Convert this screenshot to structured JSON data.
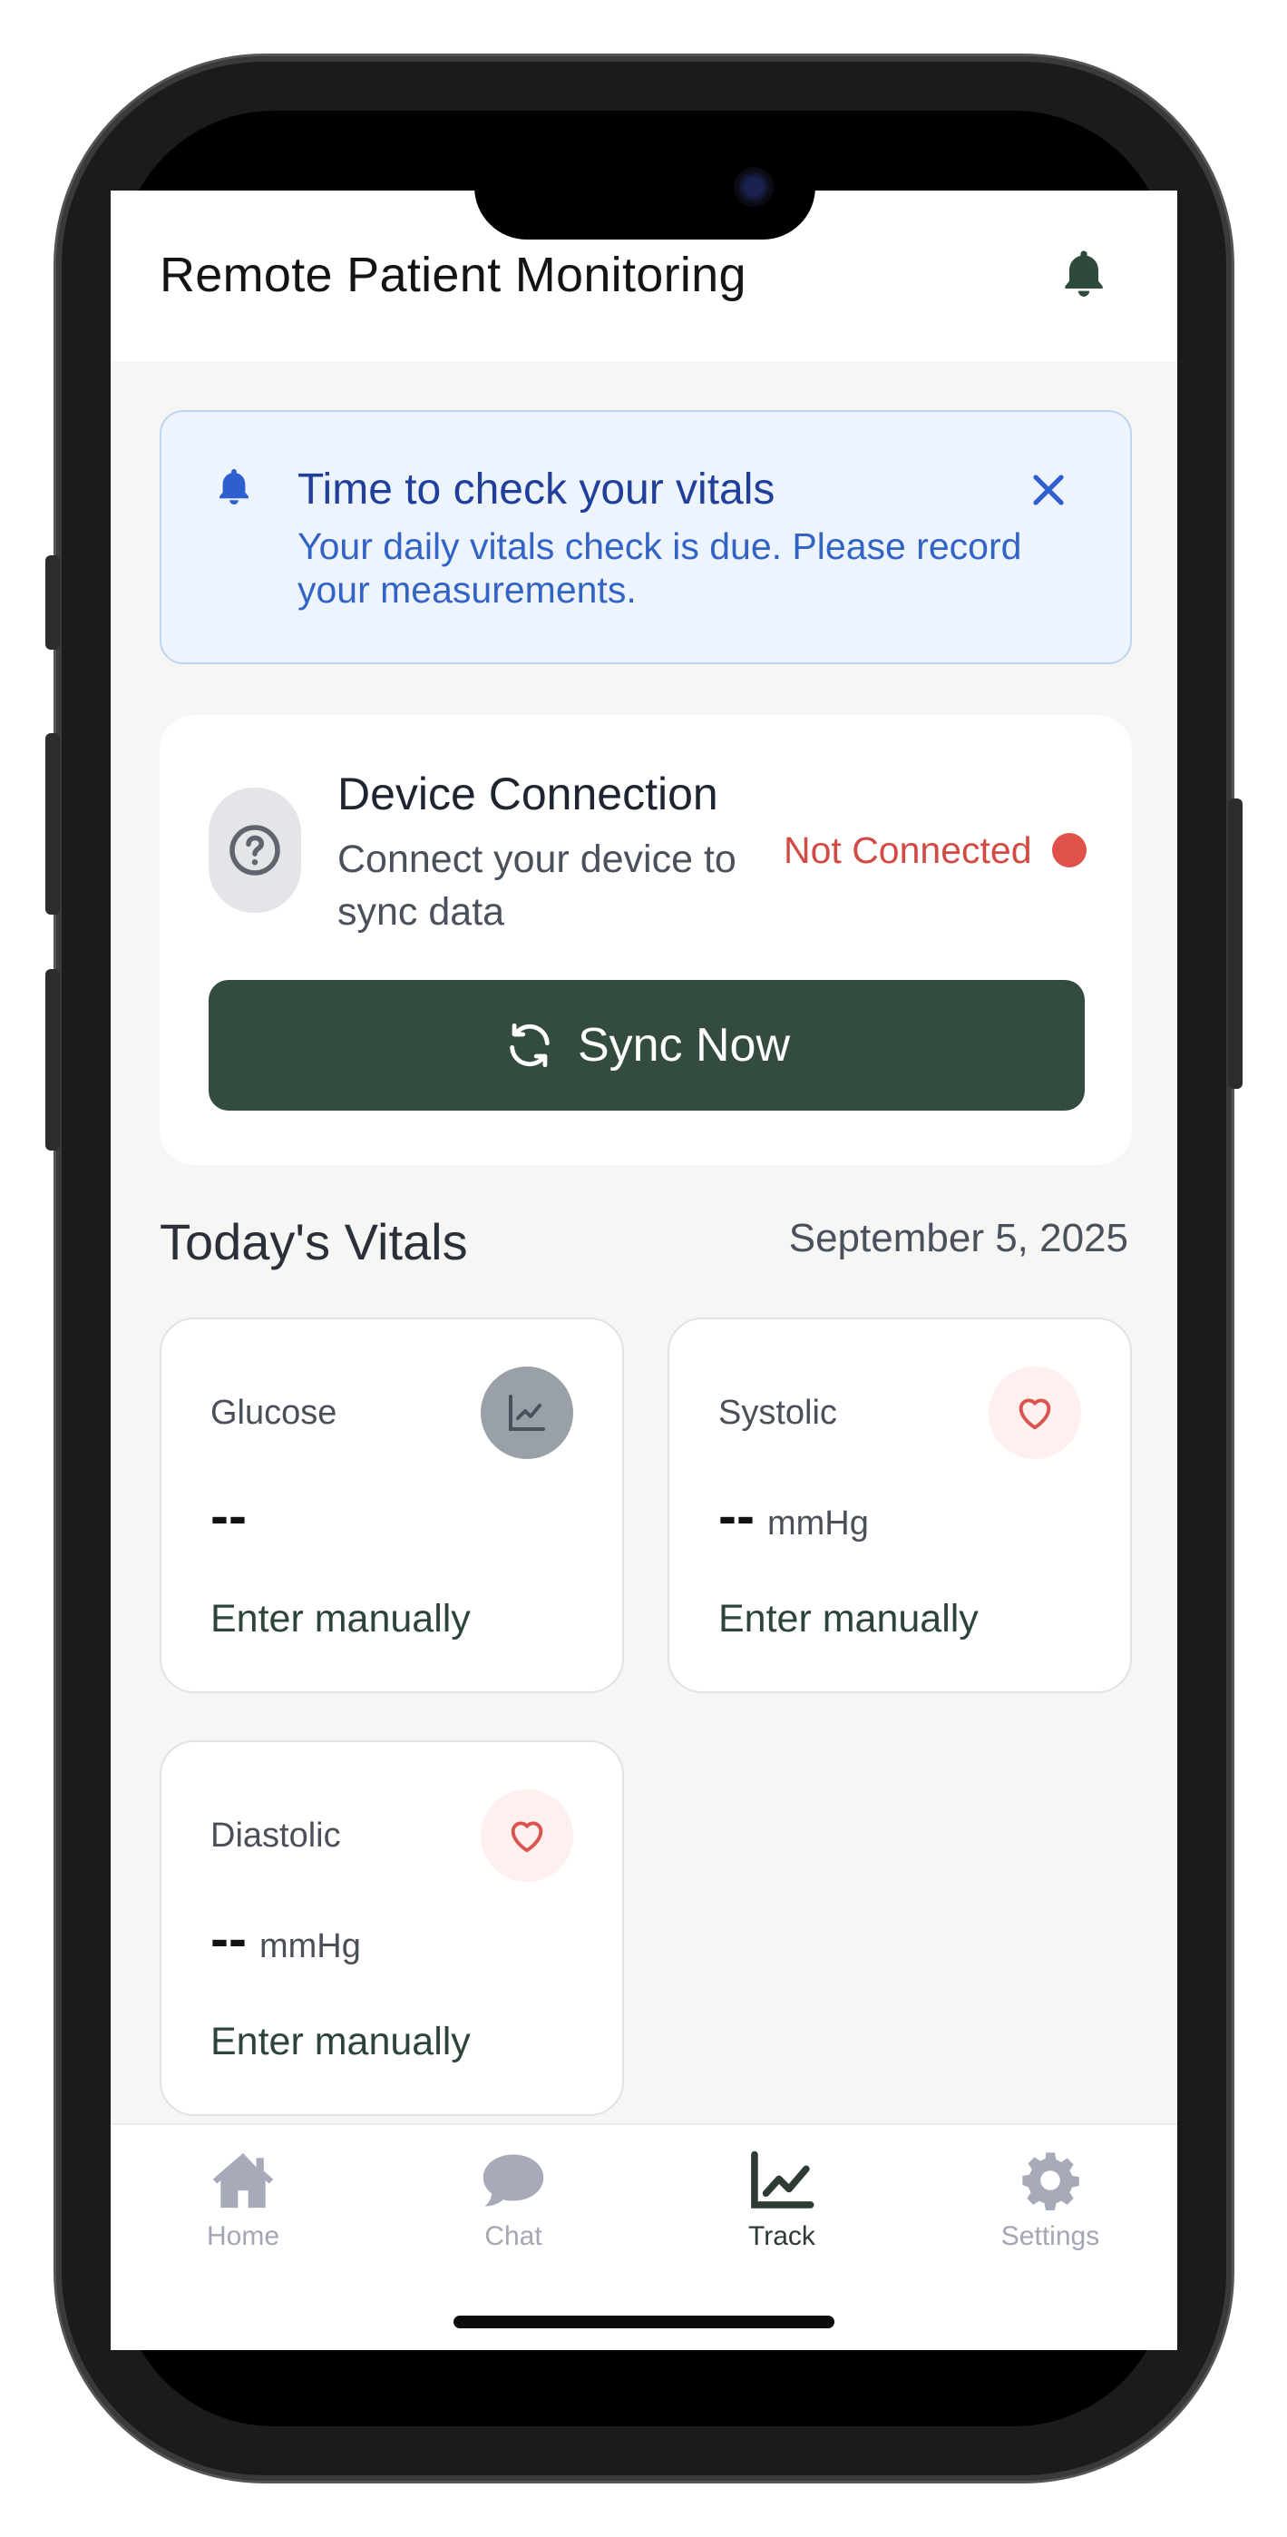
{
  "header": {
    "title": "Remote Patient Monitoring",
    "bell_icon": "bell-icon"
  },
  "alert": {
    "icon": "bell-icon",
    "title": "Time to check your vitals",
    "body": "Your daily vitals check is due. Please record your measurements.",
    "close_icon": "close-icon",
    "colors": {
      "background": "#eef4fd",
      "title": "#1f3f9a",
      "body": "#3164c4"
    }
  },
  "device": {
    "icon": "question-circle-icon",
    "title": "Device Connection",
    "subtitle": "Connect your device to sync data",
    "status": "Not Connected",
    "status_color": "#e0514a",
    "sync_button": {
      "label": "Sync Now",
      "icon": "sync-icon",
      "color": "#344c3f"
    }
  },
  "vitals": {
    "title": "Today's Vitals",
    "date": "September 5, 2025",
    "cards": [
      {
        "name": "Glucose",
        "value": "--",
        "unit": "",
        "icon": "chart-line-icon",
        "link": "Enter manually"
      },
      {
        "name": "Systolic",
        "value": "--",
        "unit": "mmHg",
        "icon": "heart-icon",
        "link": "Enter manually"
      },
      {
        "name": "Diastolic",
        "value": "--",
        "unit": "mmHg",
        "icon": "heart-icon",
        "link": "Enter manually"
      }
    ]
  },
  "nav": {
    "active": "Track",
    "items": [
      {
        "label": "Home",
        "icon": "home-icon"
      },
      {
        "label": "Chat",
        "icon": "chat-icon"
      },
      {
        "label": "Track",
        "icon": "chart-line-icon"
      },
      {
        "label": "Settings",
        "icon": "gear-icon"
      }
    ]
  }
}
